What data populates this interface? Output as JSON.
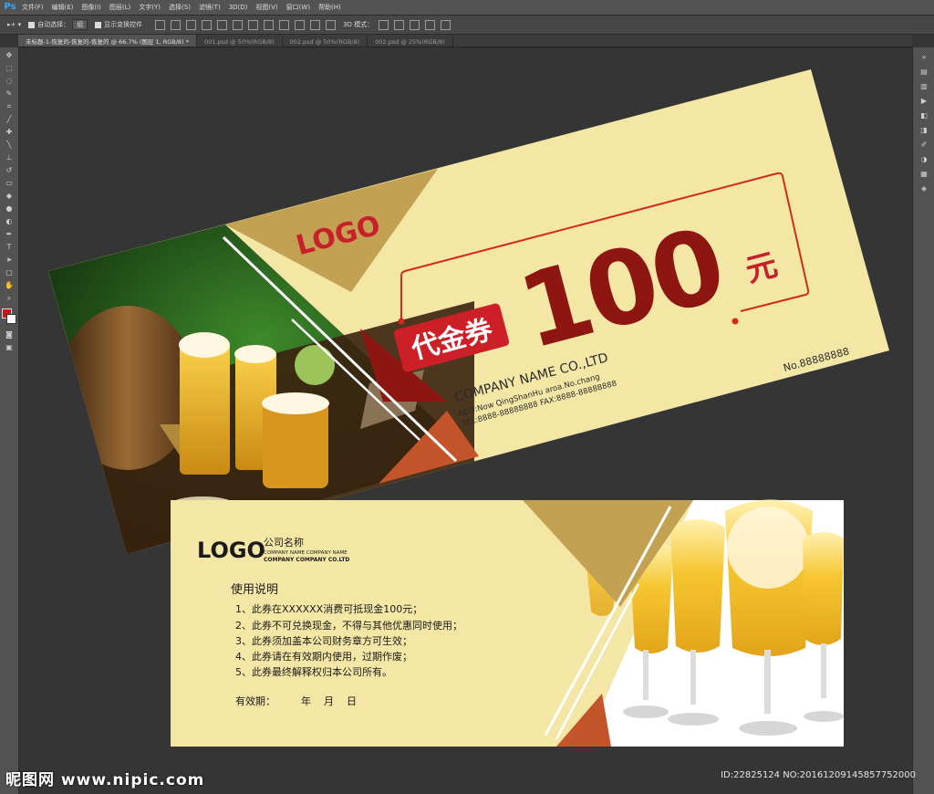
{
  "app": {
    "logo": "Ps"
  },
  "menu": [
    "文件(F)",
    "编辑(E)",
    "图像(I)",
    "图层(L)",
    "文字(Y)",
    "选择(S)",
    "滤镜(T)",
    "3D(D)",
    "视图(V)",
    "窗口(W)",
    "帮助(H)"
  ],
  "options": {
    "auto_select_label": "自动选择：",
    "auto_select_value": "组",
    "show_transform_label": "显示变换控件",
    "mode3d_label": "3D 模式："
  },
  "tabs": [
    {
      "label": "未标题-1-恢复的-恢复的-恢复的 @ 66.7% (图层 1, RGB/8) *",
      "active": true
    },
    {
      "label": "001.psd @ 50%(RGB/8)",
      "active": false
    },
    {
      "label": "002.psd @ 50%(RGB/8)",
      "active": false
    },
    {
      "label": "002.psd @ 25%(RGB/8)",
      "active": false
    }
  ],
  "front": {
    "logo": "LOGO",
    "badge": "代金券",
    "amount": "100",
    "unit": "元",
    "company": "COMPANY NAME CO.,LTD",
    "address": "ADD:Now QingShanHu aroa.No.chang",
    "phones": "TEL:8888-88888888   FAX:8888-88888888",
    "serial": "No.88888888"
  },
  "back": {
    "logo": "LOGO",
    "company_cn": "公司名称",
    "company_en1": "COMPANY NAME COMPANY NAME",
    "company_en2": "COMPANY COMPANY CO.LTD",
    "title": "使用说明",
    "rules": [
      "1、此券在XXXXXX消费可抵现金100元；",
      "2、此券不可兑换现金，不得与其他优惠同时使用；",
      "3、此券须加盖本公司财务章方可生效；",
      "4、此券请在有效期内使用，过期作废；",
      "5、此券最终解释权归本公司所有。"
    ],
    "validity": "有效期：        年    月    日"
  },
  "watermark": {
    "left": "昵图网 www.nipic.com",
    "right": "ID:22825124 NO:20161209145857752000"
  },
  "colors": {
    "card_yellow": "#f4e7a6",
    "gold": "#c2a252",
    "red": "#b51d1e",
    "dark_red": "#8e1610",
    "orange": "#c4552a"
  }
}
